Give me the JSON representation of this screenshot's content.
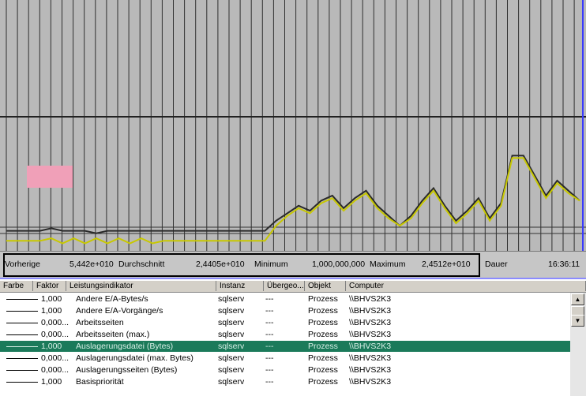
{
  "stats": {
    "last_label": "Vorherige",
    "last_value": "5,442e+010",
    "avg_label": "Durchschnitt",
    "avg_value": "2,4405e+010",
    "min_label": "Minimum",
    "min_value": "1,000,000,000",
    "max_label": "Maximum",
    "max_value": "2,4512e+010",
    "duration_label": "Dauer",
    "duration_value": "16:36:11"
  },
  "columns": [
    "Farbe",
    "Faktor",
    "Leistungsindikator",
    "Instanz",
    "Übergeo...",
    "Objekt",
    "Computer"
  ],
  "rows": [
    {
      "factor": "1,000",
      "counter": "Andere E/A-Bytes/s",
      "instance": "sqlserv",
      "parent": "---",
      "object": "Prozess",
      "computer": "\\\\BHVS2K3",
      "selected": false
    },
    {
      "factor": "1,000",
      "counter": "Andere E/A-Vorgänge/s",
      "instance": "sqlserv",
      "parent": "---",
      "object": "Prozess",
      "computer": "\\\\BHVS2K3",
      "selected": false
    },
    {
      "factor": "0,000...",
      "counter": "Arbeitsseiten",
      "instance": "sqlserv",
      "parent": "---",
      "object": "Prozess",
      "computer": "\\\\BHVS2K3",
      "selected": false
    },
    {
      "factor": "0,000...",
      "counter": "Arbeitsseiten (max.)",
      "instance": "sqlserv",
      "parent": "---",
      "object": "Prozess",
      "computer": "\\\\BHVS2K3",
      "selected": false
    },
    {
      "factor": "1,000",
      "counter": "Auslagerungsdatei (Bytes)",
      "instance": "sqlserv",
      "parent": "---",
      "object": "Prozess",
      "computer": "\\\\BHVS2K3",
      "selected": true
    },
    {
      "factor": "0,000...",
      "counter": "Auslagerungsdatei (max. Bytes)",
      "instance": "sqlserv",
      "parent": "---",
      "object": "Prozess",
      "computer": "\\\\BHVS2K3",
      "selected": false
    },
    {
      "factor": "0,000...",
      "counter": "Auslagerungsseiten (Bytes)",
      "instance": "sqlserv",
      "parent": "---",
      "object": "Prozess",
      "computer": "\\\\BHVS2K3",
      "selected": false
    },
    {
      "factor": "1,000",
      "counter": "Basispriorität",
      "instance": "sqlserv",
      "parent": "---",
      "object": "Prozess",
      "computer": "\\\\BHVS2K3",
      "selected": false
    }
  ],
  "graph_series": [
    {
      "name": "dark",
      "color": "#2a2a2a",
      "y": [
        0.92,
        0.92,
        0.92,
        0.92,
        0.91,
        0.92,
        0.92,
        0.92,
        0.93,
        0.92,
        0.92,
        0.92,
        0.92,
        0.92,
        0.92,
        0.92,
        0.92,
        0.92,
        0.92,
        0.92,
        0.92,
        0.92,
        0.92,
        0.92,
        0.88,
        0.85,
        0.82,
        0.84,
        0.8,
        0.78,
        0.83,
        0.79,
        0.76,
        0.82,
        0.86,
        0.9,
        0.86,
        0.8,
        0.75,
        0.82,
        0.88,
        0.84,
        0.79,
        0.87,
        0.81,
        0.62,
        0.62,
        0.7,
        0.78,
        0.72,
        0.76,
        0.8
      ]
    },
    {
      "name": "yellow",
      "color": "#c8c800",
      "y": [
        0.96,
        0.96,
        0.96,
        0.96,
        0.95,
        0.97,
        0.95,
        0.97,
        0.95,
        0.97,
        0.95,
        0.97,
        0.95,
        0.97,
        0.96,
        0.96,
        0.96,
        0.96,
        0.96,
        0.96,
        0.96,
        0.96,
        0.96,
        0.96,
        0.9,
        0.86,
        0.83,
        0.85,
        0.81,
        0.79,
        0.84,
        0.8,
        0.77,
        0.83,
        0.87,
        0.9,
        0.87,
        0.81,
        0.76,
        0.83,
        0.89,
        0.85,
        0.8,
        0.88,
        0.82,
        0.63,
        0.63,
        0.71,
        0.79,
        0.73,
        0.77,
        0.8
      ]
    }
  ],
  "colors": {
    "selection": "#1b7a5a",
    "graph_bg": "#b9b9b9",
    "accent_blue": "#8b8bff"
  },
  "scroll_icons": {
    "up": "arrow-up-icon",
    "down": "arrow-down-icon"
  }
}
